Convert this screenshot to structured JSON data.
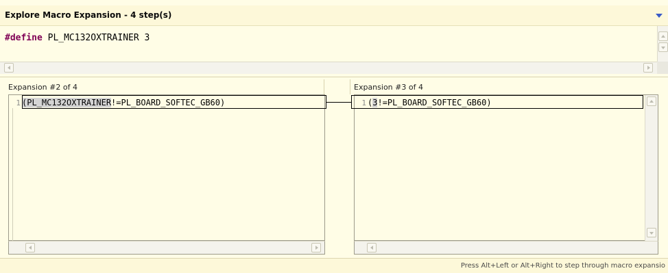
{
  "header": {
    "title": "Explore Macro Expansion - 4 step(s)"
  },
  "define": {
    "keyword": "#define",
    "rest": " PL_MC132OXTRAINER 3"
  },
  "left_panel": {
    "label": "Expansion #2 of 4",
    "line_number": "1",
    "highlighted": "(PL_MC132OXTRAINER",
    "rest": "!=PL_BOARD_SOFTEC_GB60)"
  },
  "right_panel": {
    "label": "Expansion #3 of 4",
    "line_number": "1",
    "prefix": "(",
    "highlighted": "3",
    "rest": "!=PL_BOARD_SOFTEC_GB60)"
  },
  "status": {
    "text": "Press Alt+Left or Alt+Right to step through macro expansio"
  },
  "colors": {
    "background": "#fffde6",
    "keyword": "#7f0055",
    "chevron": "#3a5bc7"
  }
}
